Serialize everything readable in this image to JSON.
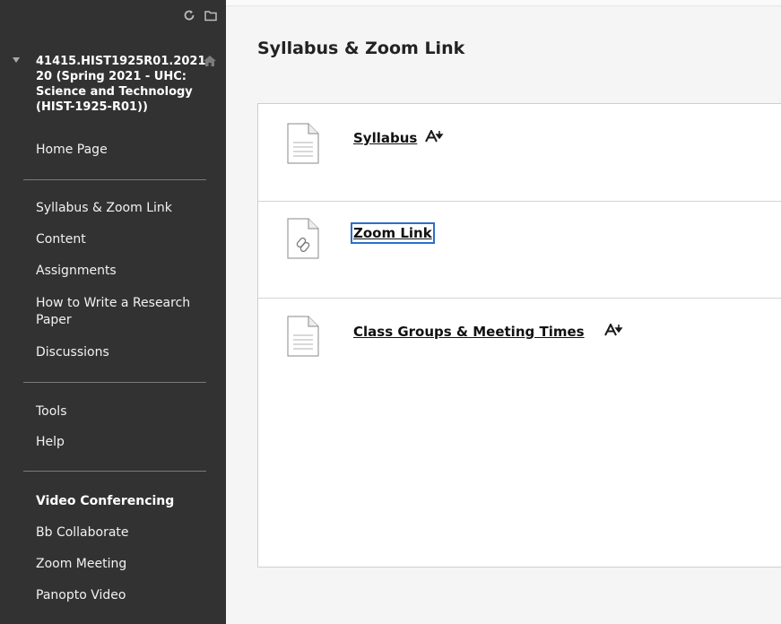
{
  "sidebar": {
    "course_title": "41415.HIST1925R01.2021 20 (Spring 2021 - UHC: Science and Technology (HIST-1925-R01))",
    "items": [
      {
        "label": "Home Page"
      },
      {
        "label": "Syllabus & Zoom Link"
      },
      {
        "label": "Content"
      },
      {
        "label": "Assignments"
      },
      {
        "label": "How to Write a Research Paper"
      },
      {
        "label": "Discussions"
      },
      {
        "label": "Tools"
      },
      {
        "label": "Help"
      }
    ],
    "section_heading": "Video Conferencing",
    "video_items": [
      {
        "label": "Bb Collaborate"
      },
      {
        "label": "Zoom Meeting"
      },
      {
        "label": "Panopto Video"
      }
    ]
  },
  "main": {
    "title": "Syllabus & Zoom Link",
    "items": [
      {
        "label": "Syllabus",
        "type": "file",
        "icon": "document-icon"
      },
      {
        "label": "Zoom Link",
        "type": "link",
        "icon": "link-document-icon"
      },
      {
        "label": "Class Groups & Meeting Times",
        "type": "file",
        "icon": "document-icon"
      }
    ]
  },
  "colors": {
    "sidebar_bg": "#323232",
    "focus_outline": "#2b6fc9"
  }
}
